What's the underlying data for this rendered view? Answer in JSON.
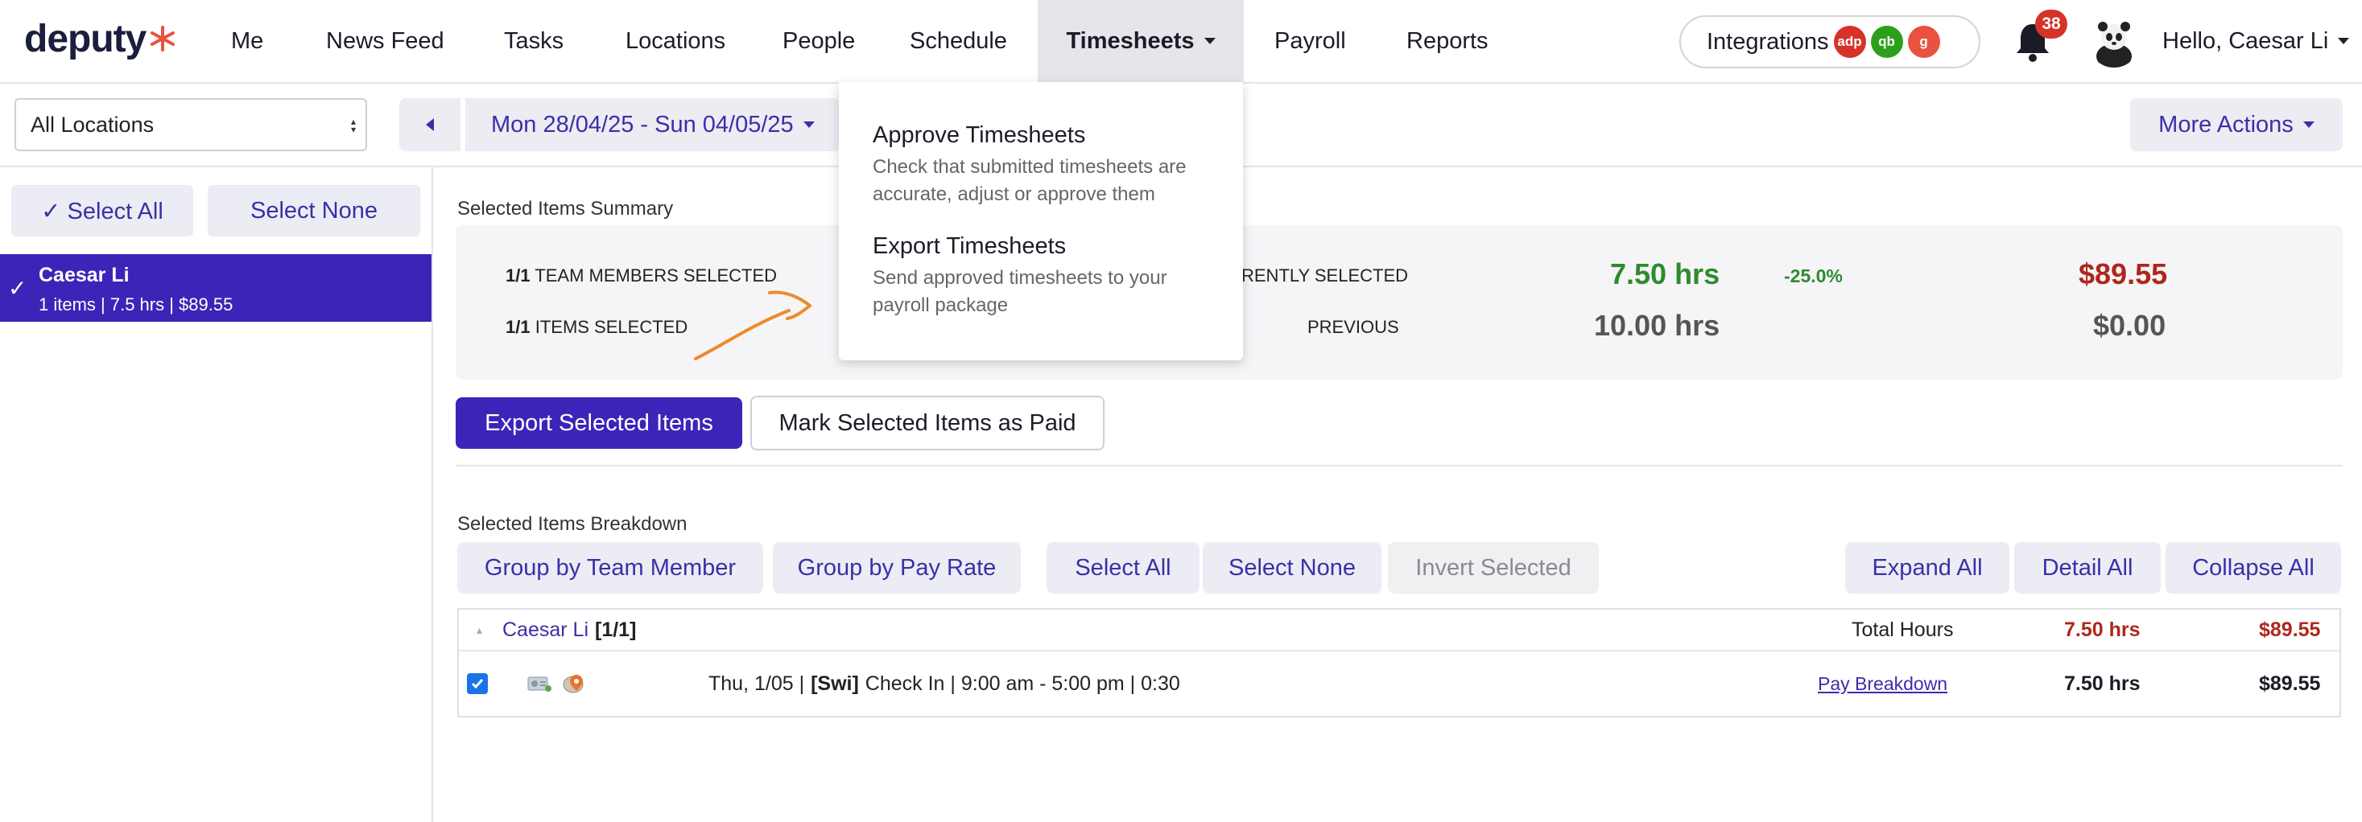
{
  "brand": {
    "logo_text": "deputy"
  },
  "nav": {
    "me": "Me",
    "news_feed": "News Feed",
    "tasks": "Tasks",
    "locations": "Locations",
    "people": "People",
    "schedule": "Schedule",
    "timesheets": "Timesheets",
    "payroll": "Payroll",
    "reports": "Reports"
  },
  "integrations": {
    "label": "Integrations",
    "badges": [
      "adp",
      "qb",
      "g"
    ],
    "colors": [
      "#d6322a",
      "#2ca01c",
      "#e8523f"
    ]
  },
  "notifications": {
    "count": "38"
  },
  "user": {
    "greeting": "Hello, Caesar Li"
  },
  "toolbar": {
    "location_select": "All Locations",
    "date_range": "Mon 28/04/25 - Sun 04/05/25",
    "more_actions": "More Actions"
  },
  "sidebar": {
    "select_all": "✓ Select All",
    "select_none": "Select None",
    "items": [
      {
        "name": "Caesar Li",
        "meta": "1 items | 7.5 hrs | $89.55"
      }
    ]
  },
  "summary": {
    "title": "Selected Items Summary",
    "team_members_count": "1/1",
    "team_members_label": "TEAM MEMBERS SELECTED",
    "items_count": "1/1",
    "items_label": "ITEMS SELECTED",
    "currently_label": "RENTLY SELECTED",
    "previous_label": "PREVIOUS",
    "current_hours": "7.50 hrs",
    "change_pct": "-25.0%",
    "current_cost": "$89.55",
    "previous_hours": "10.00 hrs",
    "previous_cost": "$0.00"
  },
  "actions": {
    "export": "Export Selected Items",
    "mark_paid": "Mark Selected Items as Paid"
  },
  "breakdown": {
    "title": "Selected Items Breakdown",
    "group_team": "Group by Team Member",
    "group_pay": "Group by Pay Rate",
    "select_all": "Select All",
    "select_none": "Select None",
    "invert": "Invert Selected",
    "expand_all": "Expand All",
    "detail_all": "Detail All",
    "collapse_all": "Collapse All"
  },
  "table": {
    "group": {
      "name": "Caesar Li",
      "count": "[1/1]",
      "total_label": "Total Hours",
      "hours": "7.50 hrs",
      "cost": "$89.55"
    },
    "row": {
      "date": "Thu, 1/05 |",
      "area": "[Swi]",
      "detail": "Check In | 9:00 am - 5:00 pm | 0:30",
      "pay_link": "Pay Breakdown",
      "hours": "7.50 hrs",
      "cost": "$89.55"
    }
  },
  "dropdown": {
    "approve_title": "Approve Timesheets",
    "approve_desc": "Check that submitted timesheets are accurate, adjust or approve them",
    "export_title": "Export Timesheets",
    "export_desc": "Send approved timesheets to your payroll package"
  },
  "colors": {
    "accent": "#3b25b8",
    "link": "#3b2fa8",
    "green": "#2e8b2e",
    "red": "#b0261c"
  }
}
